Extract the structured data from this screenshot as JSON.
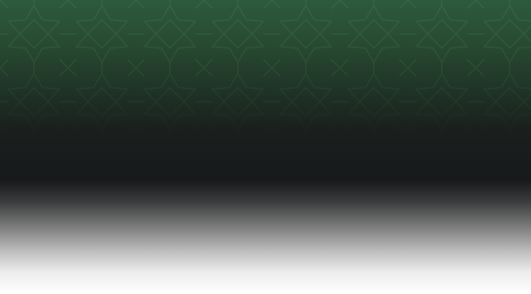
{
  "background": {
    "top_color": "#2d5a3d",
    "middle_color": "#17191b",
    "bottom_color": "#ffffff",
    "pattern_color": "#4f8a60",
    "pattern_icon": "geometric-star-lattice-icon"
  }
}
